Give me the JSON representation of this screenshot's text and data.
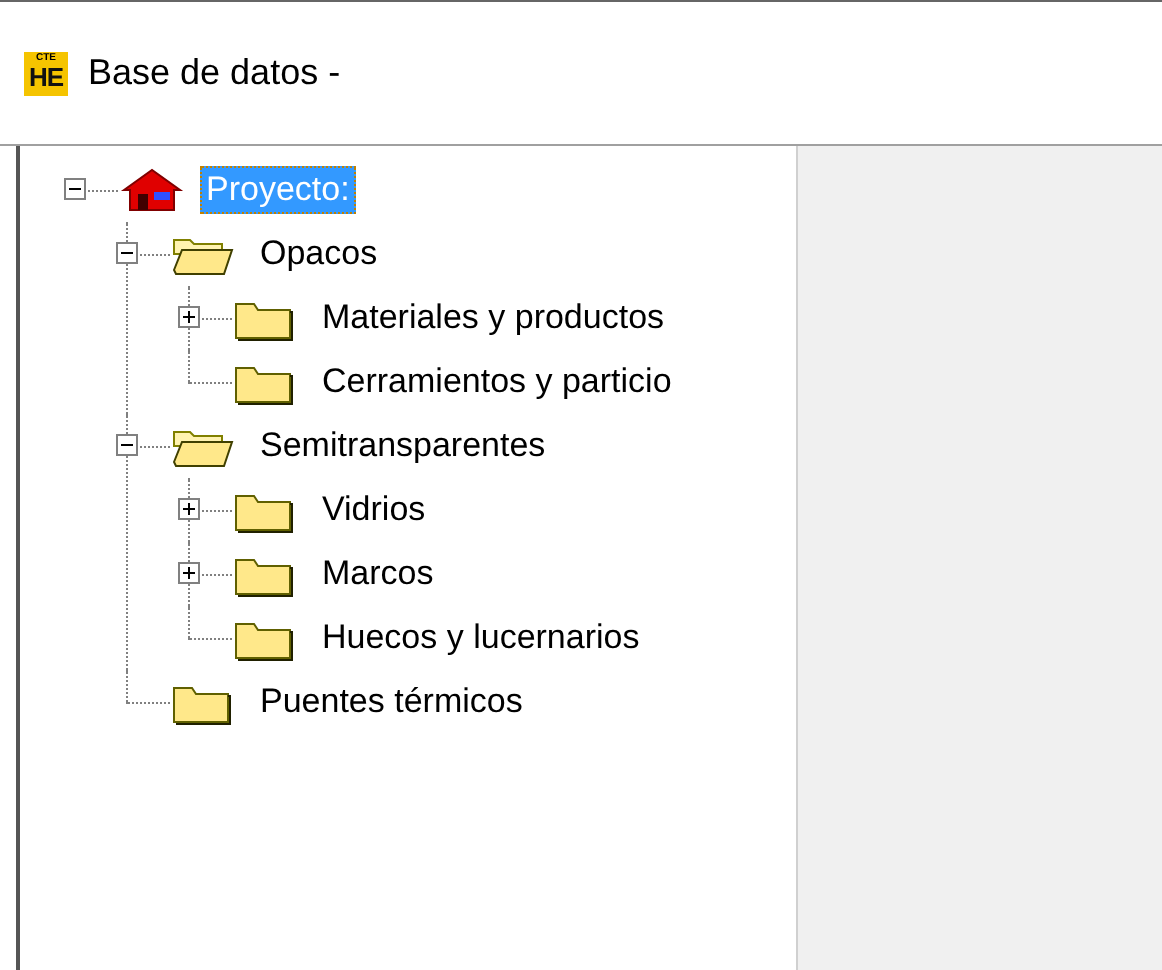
{
  "window": {
    "title": "Base de datos -",
    "app_icon": {
      "top": "CTE",
      "main": "HE"
    }
  },
  "tree": [
    {
      "label": "Proyecto:",
      "kind": "project",
      "expanded": true,
      "selected": true,
      "children": [
        {
          "label": "Opacos",
          "kind": "folder",
          "expanded": true,
          "selected": false,
          "children": [
            {
              "label": "Materiales y productos",
              "kind": "folder",
              "expanded": false,
              "selected": false
            },
            {
              "label": "Cerramientos y particio",
              "kind": "folder",
              "selected": false
            }
          ]
        },
        {
          "label": "Semitransparentes",
          "kind": "folder",
          "expanded": true,
          "selected": false,
          "children": [
            {
              "label": "Vidrios",
              "kind": "folder",
              "expanded": false,
              "selected": false
            },
            {
              "label": "Marcos",
              "kind": "folder",
              "expanded": false,
              "selected": false
            },
            {
              "label": "Huecos y lucernarios",
              "kind": "folder",
              "selected": false
            }
          ]
        },
        {
          "label": "Puentes térmicos",
          "kind": "folder",
          "selected": false
        }
      ]
    }
  ]
}
